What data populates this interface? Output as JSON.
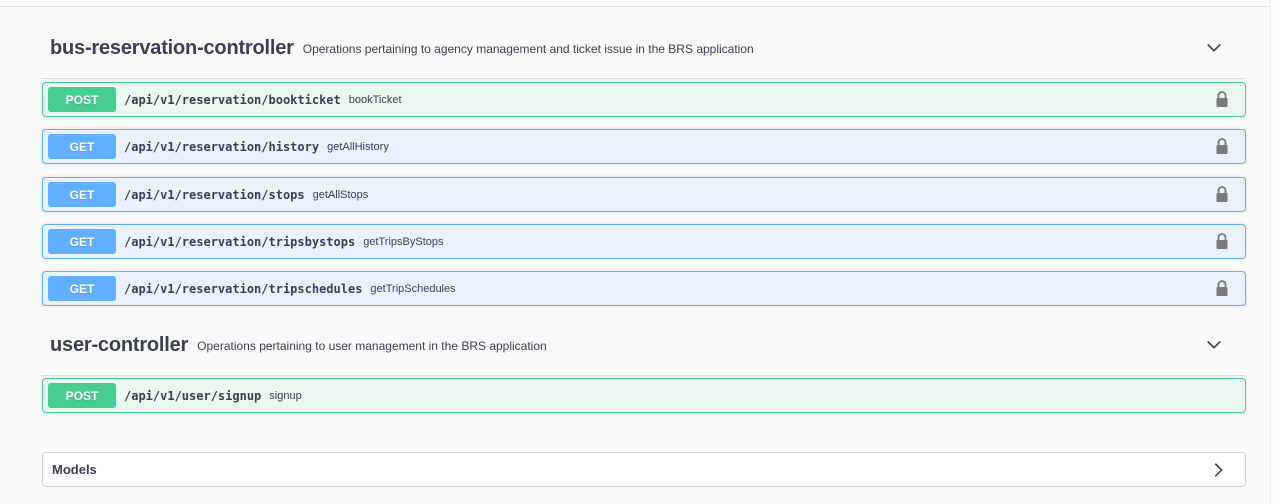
{
  "sections": [
    {
      "title": "bus-reservation-controller",
      "description": "Operations pertaining to agency management and ticket issue in the BRS application",
      "operations": [
        {
          "method": "POST",
          "path": "/api/v1/reservation/bookticket",
          "summary": "bookTicket"
        },
        {
          "method": "GET",
          "path": "/api/v1/reservation/history",
          "summary": "getAllHistory"
        },
        {
          "method": "GET",
          "path": "/api/v1/reservation/stops",
          "summary": "getAllStops"
        },
        {
          "method": "GET",
          "path": "/api/v1/reservation/tripsbystops",
          "summary": "getTripsByStops"
        },
        {
          "method": "GET",
          "path": "/api/v1/reservation/tripschedules",
          "summary": "getTripSchedules"
        }
      ]
    },
    {
      "title": "user-controller",
      "description": "Operations pertaining to user management in the BRS application",
      "operations": [
        {
          "method": "POST",
          "path": "/api/v1/user/signup",
          "summary": "signup"
        }
      ]
    }
  ],
  "models": {
    "title": "Models"
  },
  "icons": {
    "collapse": "chevron-down-icon",
    "lock": "lock-icon",
    "expand": "chevron-right-icon"
  },
  "colors": {
    "post": "#49cc90",
    "get": "#61affe",
    "post_bg": "#ebf7f1",
    "get_bg": "#eaf3fd"
  }
}
